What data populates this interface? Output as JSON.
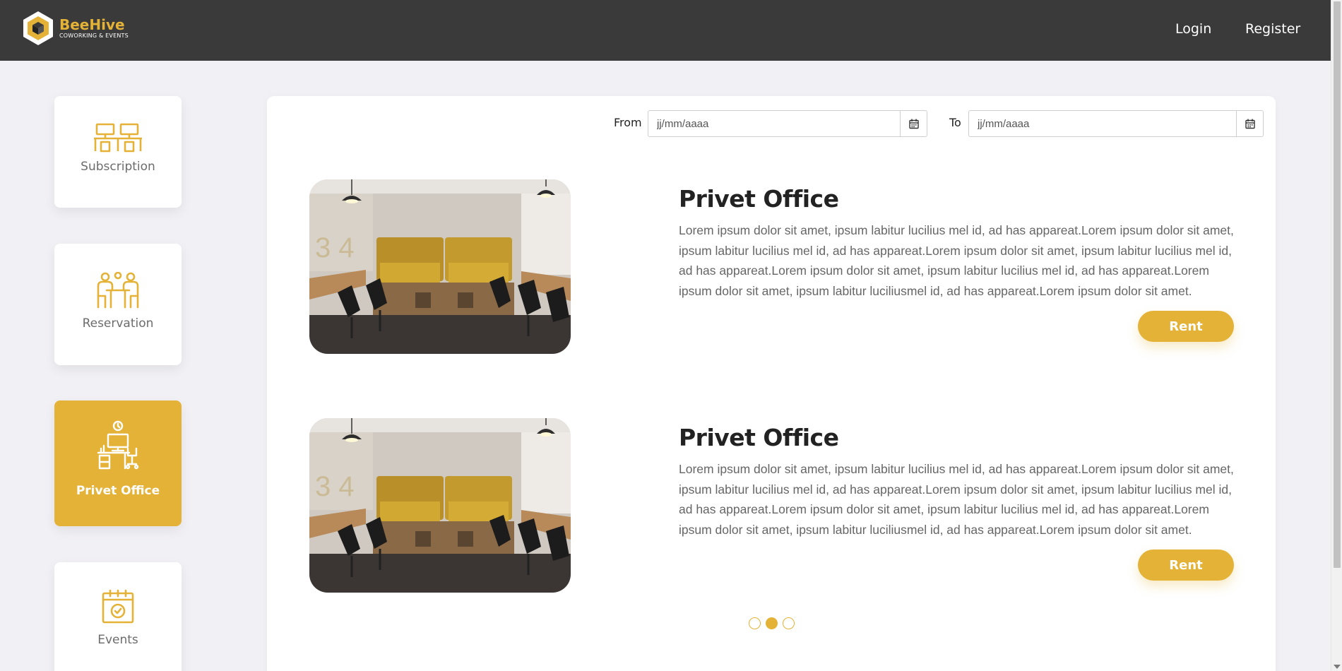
{
  "brand": {
    "name": "BeeHive",
    "tagline": "COWORKING & EVENTS",
    "accent_color": "#e4b236",
    "header_color": "#3a3a3a"
  },
  "nav": {
    "login": "Login",
    "register": "Register"
  },
  "sidebar": {
    "items": [
      {
        "label": "Subscription",
        "icon": "workspace-desks-icon",
        "active": false
      },
      {
        "label": "Reservation",
        "icon": "meeting-table-icon",
        "active": false
      },
      {
        "label": "Privet Office",
        "icon": "office-desk-clock-icon",
        "active": true
      },
      {
        "label": "Events",
        "icon": "calendar-check-icon",
        "active": false
      }
    ]
  },
  "filters": {
    "from_label": "From",
    "from_placeholder": "jj/mm/aaaa",
    "to_label": "To",
    "to_placeholder": "jj/mm/aaaa",
    "calendar_icon": "calendar-icon"
  },
  "offices": [
    {
      "title": "Privet Office",
      "description": "Lorem ipsum dolor sit amet, ipsum labitur lucilius mel id, ad has appareat.Lorem ipsum dolor sit amet, ipsum labitur lucilius mel id, ad has appareat.Lorem ipsum dolor sit amet, ipsum labitur lucilius mel id, ad has appareat.Lorem ipsum dolor sit amet, ipsum labitur lucilius mel id, ad has appareat.Lorem ipsum dolor sit amet, ipsum labitur luciliusmel id, ad has appareat.Lorem ipsum dolor sit amet.",
      "button": "Rent"
    },
    {
      "title": "Privet Office",
      "description": "Lorem ipsum dolor sit amet, ipsum labitur lucilius mel id, ad has appareat.Lorem ipsum dolor sit amet, ipsum labitur lucilius mel id, ad has appareat.Lorem ipsum dolor sit amet, ipsum labitur lucilius mel id, ad has appareat.Lorem ipsum dolor sit amet, ipsum labitur lucilius mel id, ad has appareat.Lorem ipsum dolor sit amet, ipsum labitur luciliusmel id, ad has appareat.Lorem ipsum dolor sit amet.",
      "button": "Rent"
    }
  ],
  "pagination": {
    "pages": 3,
    "current": 2
  }
}
